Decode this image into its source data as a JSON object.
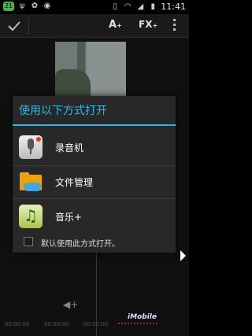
{
  "status_bar": {
    "notification_badge": "21",
    "time": "11:41",
    "icons": [
      "usb-icon",
      "usb-debug-icon",
      "sync-icon",
      "sim-icon",
      "wifi-icon",
      "signal-icon",
      "battery-icon"
    ]
  },
  "action_bar": {
    "done_icon": "check-icon",
    "text_tool_label": "A",
    "fx_label": "FX",
    "overflow_icon": "overflow-menu-icon"
  },
  "dialog": {
    "title": "使用以下方式打开",
    "accent_color": "#33b5e5",
    "options": [
      {
        "label": "录音机",
        "icon": "sound-recorder-icon"
      },
      {
        "label": "文件管理",
        "icon": "file-manager-icon"
      },
      {
        "label": "音乐+",
        "icon": "music-icon"
      }
    ],
    "default_checkbox_label": "默认使用此方式打开。",
    "default_checked": false
  },
  "editor": {
    "timecode_left": "00:00:00",
    "timecode_mid": "00:00:00",
    "timecode_right": "00:00:00",
    "watermark": "iMobile"
  }
}
